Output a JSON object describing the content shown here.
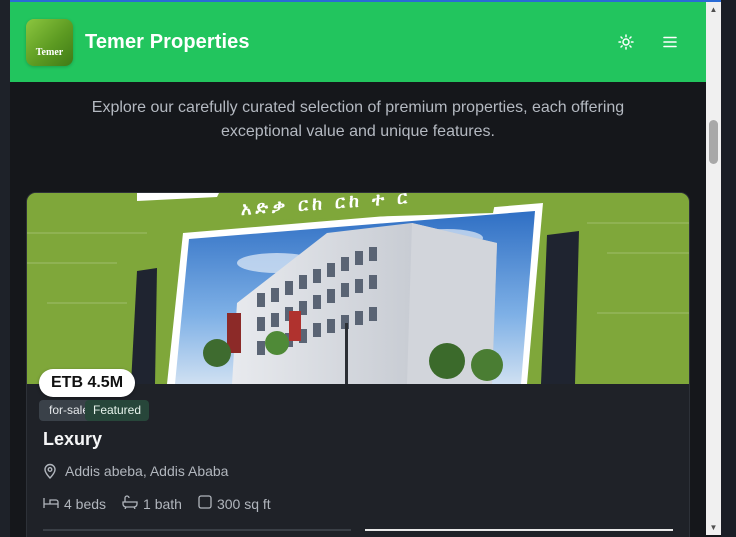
{
  "header": {
    "logo_text": "Temer",
    "title": "Temer Properties",
    "theme_icon": "sun-icon",
    "menu_icon": "menu-icon"
  },
  "intro": {
    "text": "Explore our carefully curated selection of premium properties, each offering exceptional value and unique features."
  },
  "listing": {
    "price": "ETB 4.5M",
    "status": "for-sale",
    "featured": "Featured",
    "title": "Lexury",
    "location": "Addis abeba, Addis Ababa",
    "beds": "4 beds",
    "baths": "1 bath",
    "area": "300 sq ft",
    "image_banner_text": "አድቃ ርከ ርከ ተ ር"
  },
  "colors": {
    "header_bg": "#22c55e",
    "page_bg": "#15171b",
    "card_bg": "#1f2228",
    "image_green": "#7fa73a"
  }
}
